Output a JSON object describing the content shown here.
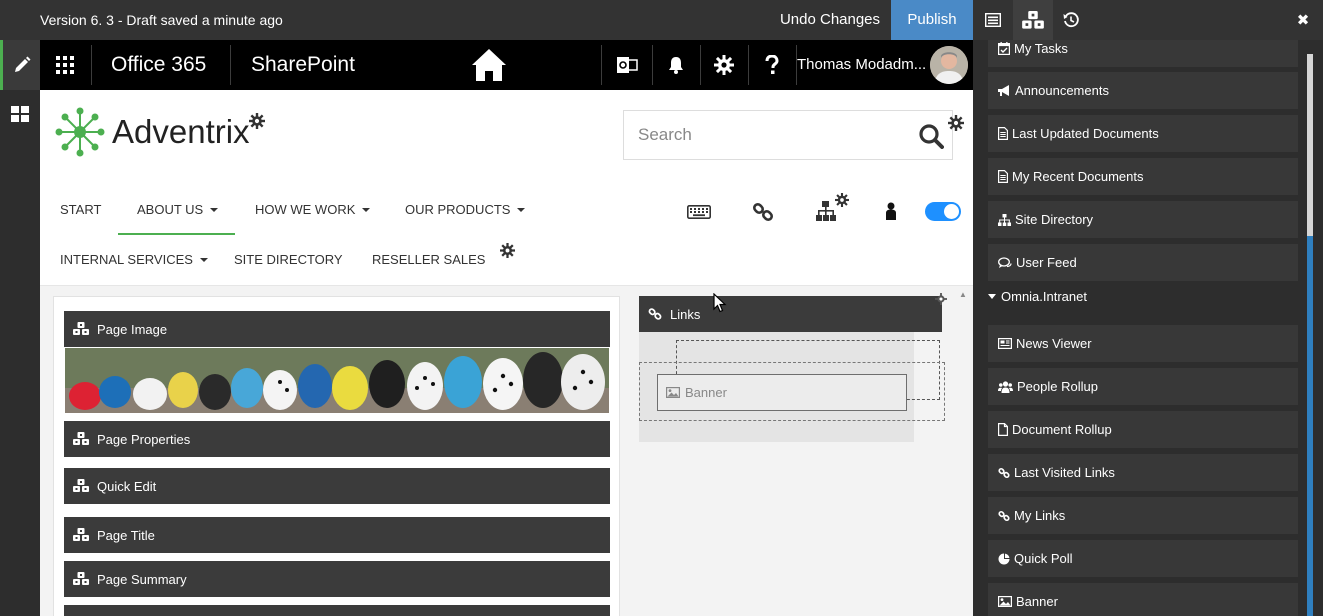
{
  "editor_bar": {
    "version_text": "Version 6. 3 - Draft saved a minute ago",
    "undo_label": "Undo Changes",
    "publish_label": "Publish",
    "colors": {
      "bar": "#333333",
      "publish": "#4a8ac7"
    }
  },
  "suite_bar": {
    "app_name": "Office 365",
    "product": "SharePoint",
    "user_name": "Thomas Modadm..."
  },
  "site": {
    "logo_text": "Adventrix",
    "search_placeholder": "Search",
    "accent": "#4caf50"
  },
  "nav": {
    "row1": [
      {
        "label": "START",
        "dropdown": false
      },
      {
        "label": "ABOUT US",
        "dropdown": true,
        "active": true
      },
      {
        "label": "HOW WE WORK",
        "dropdown": true
      },
      {
        "label": "OUR PRODUCTS",
        "dropdown": true
      }
    ],
    "row2": [
      {
        "label": "INTERNAL SERVICES",
        "dropdown": true
      },
      {
        "label": "SITE DIRECTORY",
        "dropdown": false
      },
      {
        "label": "RESELLER SALES",
        "dropdown": false
      }
    ],
    "toggle_on": true
  },
  "zones": {
    "left": [
      {
        "label": "Page Image"
      },
      {
        "label": "Page Properties"
      },
      {
        "label": "Quick Edit"
      },
      {
        "label": "Page Title"
      },
      {
        "label": "Page Summary"
      }
    ],
    "right": {
      "links_label": "Links",
      "drag_label": "Banner"
    }
  },
  "toolbox": {
    "items_top": [
      {
        "label": "My Tasks",
        "icon": "calendar-check-icon"
      },
      {
        "label": "Announcements",
        "icon": "megaphone-icon"
      },
      {
        "label": "Last Updated Documents",
        "icon": "document-icon"
      },
      {
        "label": "My Recent Documents",
        "icon": "document-icon"
      },
      {
        "label": "Site Directory",
        "icon": "sitemap-icon"
      },
      {
        "label": "User Feed",
        "icon": "comments-icon"
      }
    ],
    "group_label": "Omnia.Intranet",
    "items_group": [
      {
        "label": "News Viewer",
        "icon": "newspaper-icon"
      },
      {
        "label": "People Rollup",
        "icon": "users-icon"
      },
      {
        "label": "Document Rollup",
        "icon": "file-icon"
      },
      {
        "label": "Last Visited Links",
        "icon": "link-icon"
      },
      {
        "label": "My Links",
        "icon": "link-icon"
      },
      {
        "label": "Quick Poll",
        "icon": "pie-chart-icon"
      },
      {
        "label": "Banner",
        "icon": "image-icon"
      }
    ],
    "close_glyph": "✖"
  }
}
